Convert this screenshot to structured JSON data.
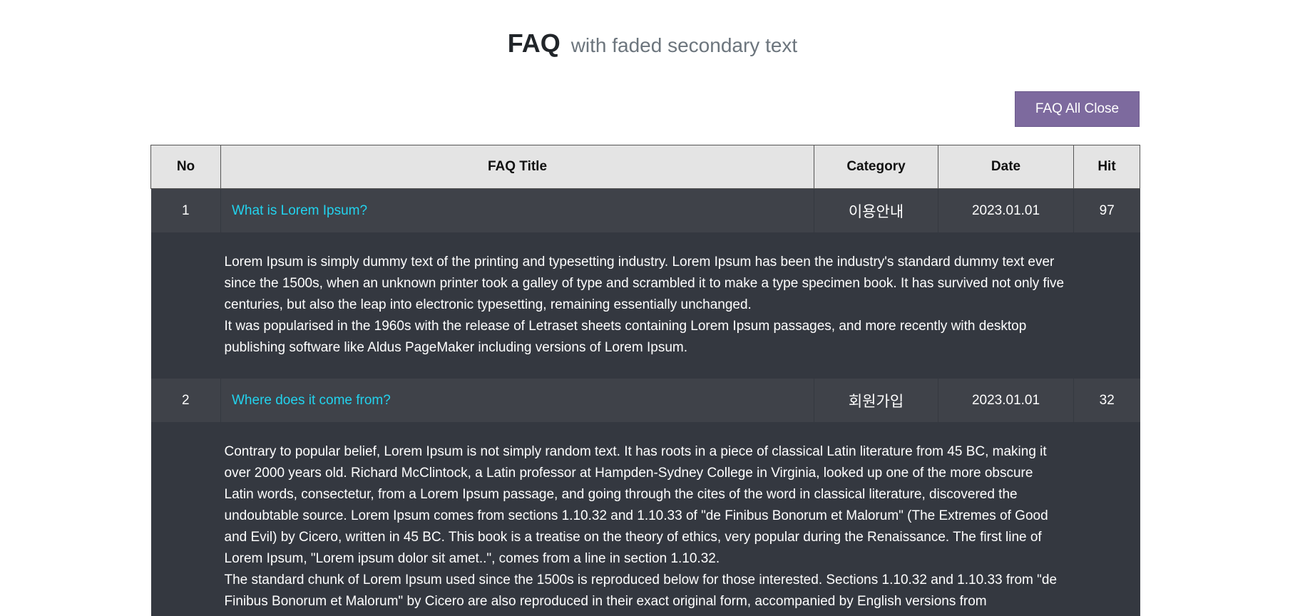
{
  "heading": {
    "main": "FAQ",
    "sub": "with faded secondary text"
  },
  "toolbar": {
    "close_all_label": "FAQ All Close"
  },
  "table": {
    "columns": [
      "No",
      "FAQ Title",
      "Category",
      "Date",
      "Hit"
    ],
    "rows": [
      {
        "no": "1",
        "title": "What is Lorem Ipsum?",
        "category": "이용안내",
        "date": "2023.01.01",
        "hit": "97",
        "answer": [
          "Lorem Ipsum is simply dummy text of the printing and typesetting industry. Lorem Ipsum has been the industry's standard dummy text ever since the 1500s, when an unknown printer took a galley of type and scrambled it to make a type specimen book. It has survived not only five centuries, but also the leap into electronic typesetting, remaining essentially unchanged.",
          "It was popularised in the 1960s with the release of Letraset sheets containing Lorem Ipsum passages, and more recently with desktop publishing software like Aldus PageMaker including versions of Lorem Ipsum."
        ]
      },
      {
        "no": "2",
        "title": "Where does it come from?",
        "category": "회원가입",
        "date": "2023.01.01",
        "hit": "32",
        "answer": [
          "Contrary to popular belief, Lorem Ipsum is not simply random text. It has roots in a piece of classical Latin literature from 45 BC, making it over 2000 years old. Richard McClintock, a Latin professor at Hampden-Sydney College in Virginia, looked up one of the more obscure Latin words, consectetur, from a Lorem Ipsum passage, and going through the cites of the word in classical literature, discovered the undoubtable source. Lorem Ipsum comes from sections 1.10.32 and 1.10.33 of \"de Finibus Bonorum et Malorum\" (The Extremes of Good and Evil) by Cicero, written in 45 BC. This book is a treatise on the theory of ethics, very popular during the Renaissance. The first line of Lorem Ipsum, \"Lorem ipsum dolor sit amet..\", comes from a line in section 1.10.32.",
          "The standard chunk of Lorem Ipsum used since the 1500s is reproduced below for those interested. Sections 1.10.32 and 1.10.33 from \"de Finibus Bonorum et Malorum\" by Cicero are also reproduced in their exact original form, accompanied by English versions from"
        ]
      }
    ]
  }
}
